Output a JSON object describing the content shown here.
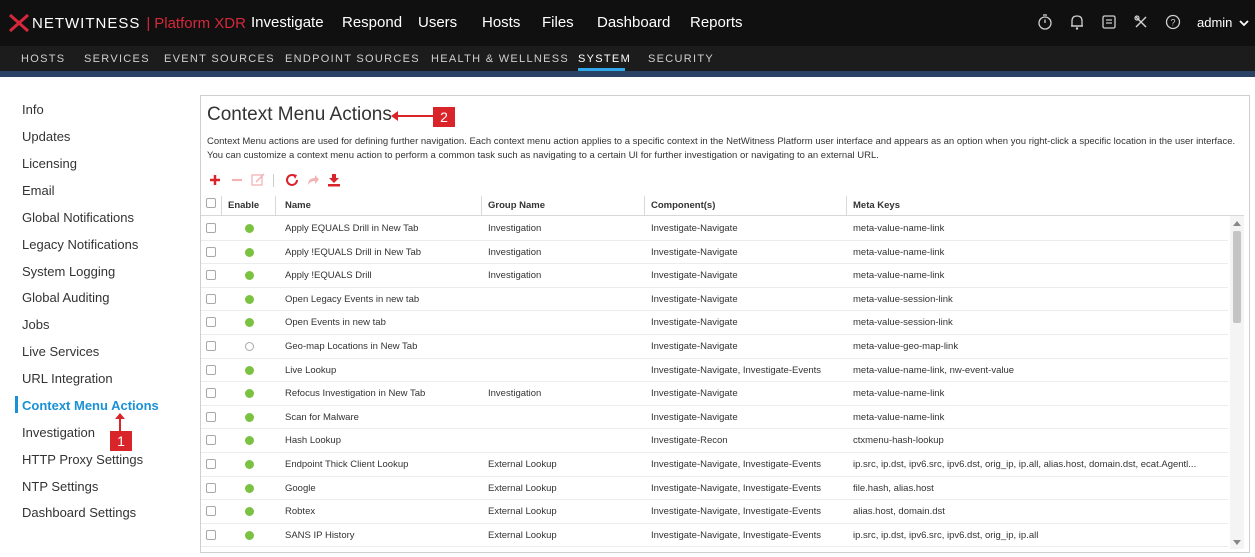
{
  "app": {
    "brand": "NETWITNESS",
    "separator": "|",
    "product": "Platform XDR"
  },
  "top_nav": [
    "Investigate",
    "Respond",
    "Users",
    "Hosts",
    "Files",
    "Dashboard",
    "Reports"
  ],
  "top_icons": [
    "timer-icon",
    "bell-icon",
    "tasks-icon",
    "tools-icon",
    "help-icon"
  ],
  "user_menu": {
    "label": "admin"
  },
  "sub_nav": {
    "items": [
      "HOSTS",
      "SERVICES",
      "EVENT SOURCES",
      "ENDPOINT SOURCES",
      "HEALTH & WELLNESS",
      "SYSTEM",
      "SECURITY"
    ],
    "active": "SYSTEM"
  },
  "sidebar": {
    "items": [
      "Info",
      "Updates",
      "Licensing",
      "Email",
      "Global Notifications",
      "Legacy Notifications",
      "System Logging",
      "Global Auditing",
      "Jobs",
      "Live Services",
      "URL Integration",
      "Context Menu Actions",
      "Investigation",
      "HTTP Proxy Settings",
      "NTP Settings",
      "Dashboard Settings"
    ],
    "active": "Context Menu Actions"
  },
  "page": {
    "title": "Context Menu Actions",
    "description": "Context Menu actions are used for defining further navigation. Each context menu action applies to a specific context in the NetWitness Platform user interface and appears as an option when you right-click a specific location in the user interface. You can customize a context menu action to perform a common task such as navigating to a certain UI for further investigation or navigating to an external URL."
  },
  "toolbar": {
    "icons": [
      "add-icon",
      "remove-icon",
      "edit-icon",
      "refresh-icon",
      "export-icon",
      "import-icon"
    ]
  },
  "table": {
    "columns": [
      "Enable",
      "Name",
      "Group Name",
      "Component(s)",
      "Meta Keys"
    ],
    "rows": [
      {
        "enabled": true,
        "name": "Apply EQUALS Drill in New Tab",
        "group": "Investigation",
        "components": "Investigate-Navigate",
        "meta": "meta-value-name-link"
      },
      {
        "enabled": true,
        "name": "Apply !EQUALS Drill in New Tab",
        "group": "Investigation",
        "components": "Investigate-Navigate",
        "meta": "meta-value-name-link"
      },
      {
        "enabled": true,
        "name": "Apply !EQUALS Drill",
        "group": "Investigation",
        "components": "Investigate-Navigate",
        "meta": "meta-value-name-link"
      },
      {
        "enabled": true,
        "name": "Open Legacy Events in new tab",
        "group": "",
        "components": "Investigate-Navigate",
        "meta": "meta-value-session-link"
      },
      {
        "enabled": true,
        "name": "Open Events in new tab",
        "group": "",
        "components": "Investigate-Navigate",
        "meta": "meta-value-session-link"
      },
      {
        "enabled": false,
        "name": "Geo-map Locations in New Tab",
        "group": "",
        "components": "Investigate-Navigate",
        "meta": "meta-value-geo-map-link"
      },
      {
        "enabled": true,
        "name": "Live Lookup",
        "group": "",
        "components": "Investigate-Navigate, Investigate-Events",
        "meta": "meta-value-name-link, nw-event-value"
      },
      {
        "enabled": true,
        "name": "Refocus Investigation in New Tab",
        "group": "Investigation",
        "components": "Investigate-Navigate",
        "meta": "meta-value-name-link"
      },
      {
        "enabled": true,
        "name": "Scan for Malware",
        "group": "",
        "components": "Investigate-Navigate",
        "meta": "meta-value-name-link"
      },
      {
        "enabled": true,
        "name": "Hash Lookup",
        "group": "",
        "components": "Investigate-Recon",
        "meta": "ctxmenu-hash-lookup"
      },
      {
        "enabled": true,
        "name": "Endpoint Thick Client Lookup",
        "group": "External Lookup",
        "components": "Investigate-Navigate, Investigate-Events",
        "meta": "ip.src, ip.dst, ipv6.src, ipv6.dst, orig_ip, ip.all, alias.host, domain.dst, ecat.Agentl..."
      },
      {
        "enabled": true,
        "name": "Google",
        "group": "External Lookup",
        "components": "Investigate-Navigate, Investigate-Events",
        "meta": "file.hash, alias.host"
      },
      {
        "enabled": true,
        "name": "Robtex",
        "group": "External Lookup",
        "components": "Investigate-Navigate, Investigate-Events",
        "meta": "alias.host, domain.dst"
      },
      {
        "enabled": true,
        "name": "SANS IP History",
        "group": "External Lookup",
        "components": "Investigate-Navigate, Investigate-Events",
        "meta": "ip.src, ip.dst, ipv6.src, ipv6.dst, orig_ip, ip.all"
      }
    ]
  },
  "annotations": {
    "callout_1": "1",
    "callout_2": "2",
    "color": "#d9252a"
  },
  "colors": {
    "accent": "#1a91d6",
    "brand_red": "#d5283b",
    "enabled_dot": "#7cc242"
  }
}
